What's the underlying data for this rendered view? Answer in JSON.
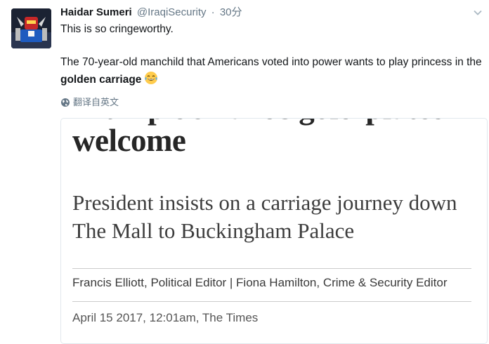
{
  "tweet": {
    "display_name": "Haidar Sumeri",
    "handle": "@IraqiSecurity",
    "separator": "·",
    "time": "30分",
    "text_line1": "This is so cringeworthy.",
    "text_p2_start": "The 70-year-old manchild that Americans voted into power wants to play princess in the ",
    "text_p2_bold": "golden carriage",
    "emoji": "face-with-tears-of-joy-emoji",
    "translate_label": "翻译自英文"
  },
  "card": {
    "headline": "Trump demands gold-plated welcome",
    "subhead": "President insists on a carriage journey down The Mall to Buckingham Palace",
    "byline": "Francis Elliott, Political Editor | Fiona Hamilton, Crime & Security Editor",
    "dateline": "April 15 2017, 12:01am, The Times"
  },
  "icons": {
    "avatar": "avatar-robot-image",
    "caret": "chevron-down-icon",
    "globe": "globe-icon"
  },
  "colors": {
    "text": "#14171a",
    "secondary": "#657786",
    "card_border": "#e1e8ed"
  }
}
